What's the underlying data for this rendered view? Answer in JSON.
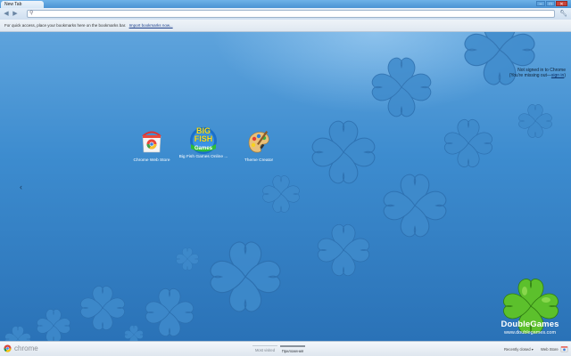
{
  "window": {
    "tab_title": "New Tab",
    "minimize": "–",
    "maximize": "□",
    "close": "✕"
  },
  "toolbar": {
    "url_value": "",
    "icons": [
      "back-icon",
      "forward-icon",
      "search-icon",
      "wrench-icon"
    ]
  },
  "bookmarks_bar": {
    "message": "For quick access, place your bookmarks here on the bookmarks bar.",
    "import_link": "Import bookmarks now..."
  },
  "signin": {
    "line1": "Not signed in to Chrome",
    "line2_prefix": "(You're missing out—",
    "line2_link": "sign in",
    "line2_suffix": ")"
  },
  "apps": [
    {
      "label": "Chrome Web Store",
      "icon": "chrome-web-store-icon"
    },
    {
      "label": "Big Fish Games Online ...",
      "icon": "big-fish-games-icon"
    },
    {
      "label": "Theme Creator",
      "icon": "theme-creator-icon"
    }
  ],
  "big_fish_logo": {
    "line1": "BIG",
    "line2": "FISH",
    "line3": "Games"
  },
  "nav": {
    "left_arrow": "‹"
  },
  "branding": {
    "title": "DoubleGames",
    "url": "www.doublegames.com"
  },
  "footer": {
    "chrome_word": "chrome",
    "tabs": [
      "Most visited",
      "Приложения"
    ],
    "active_tab": "Приложения",
    "recently_closed": "Recently closed ▾",
    "web_store": "Web Store"
  },
  "colors": {
    "background_top": "#5ea3dc",
    "background_bottom": "#2a72b7",
    "clover": "#4a94d4"
  }
}
